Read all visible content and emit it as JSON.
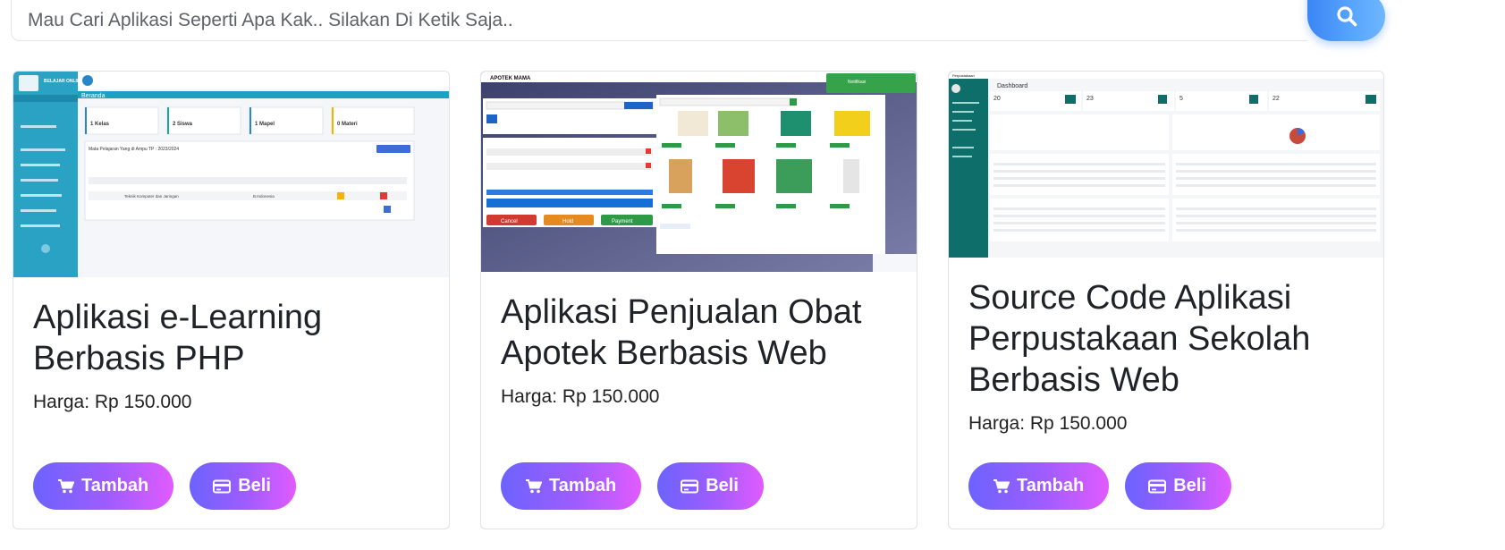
{
  "search": {
    "placeholder": "Mau Cari Aplikasi Seperti Apa Kak.. Silakan Di Ketik Saja.."
  },
  "colors": {
    "search_button": "#4d9bff",
    "button_gradient_start": "#6c63ff",
    "button_gradient_end": "#e15bff"
  },
  "products": [
    {
      "title": "Aplikasi e-Learning Berbasis PHP",
      "price": "Harga: Rp 150.000",
      "add_label": "Tambah",
      "buy_label": "Beli",
      "thumb": {
        "brand": "BELAJAR ONLINE",
        "page": "Beranda",
        "stats": [
          "1 Kelas",
          "2 Siswa",
          "1 Mapel",
          "0 Materi"
        ],
        "table_title": "Mata Pelajaran Yang di Ampu TP : 2023/2024",
        "row_subject": "Teknik Komputer dan Jaringan",
        "row_lang": "B.Indonesia"
      }
    },
    {
      "title": "Aplikasi Penjualan Obat Apotek Berbasis Web",
      "price": "Harga: Rp 150.000",
      "add_label": "Tambah",
      "buy_label": "Beli",
      "thumb": {
        "brand": "APOTEK MAMA",
        "cancel": "Cancel",
        "hold": "Hold",
        "payment": "Payment",
        "notice": "Notifikasi"
      }
    },
    {
      "title": "Source Code Aplikasi Perpustakaan Sekolah Berbasis Web",
      "price": "Harga: Rp 150.000",
      "add_label": "Tambah",
      "buy_label": "Beli",
      "thumb": {
        "brand": "Perpustakaan",
        "page": "Dashboard",
        "stats": [
          "20",
          "23",
          "5",
          "22"
        ]
      }
    }
  ]
}
